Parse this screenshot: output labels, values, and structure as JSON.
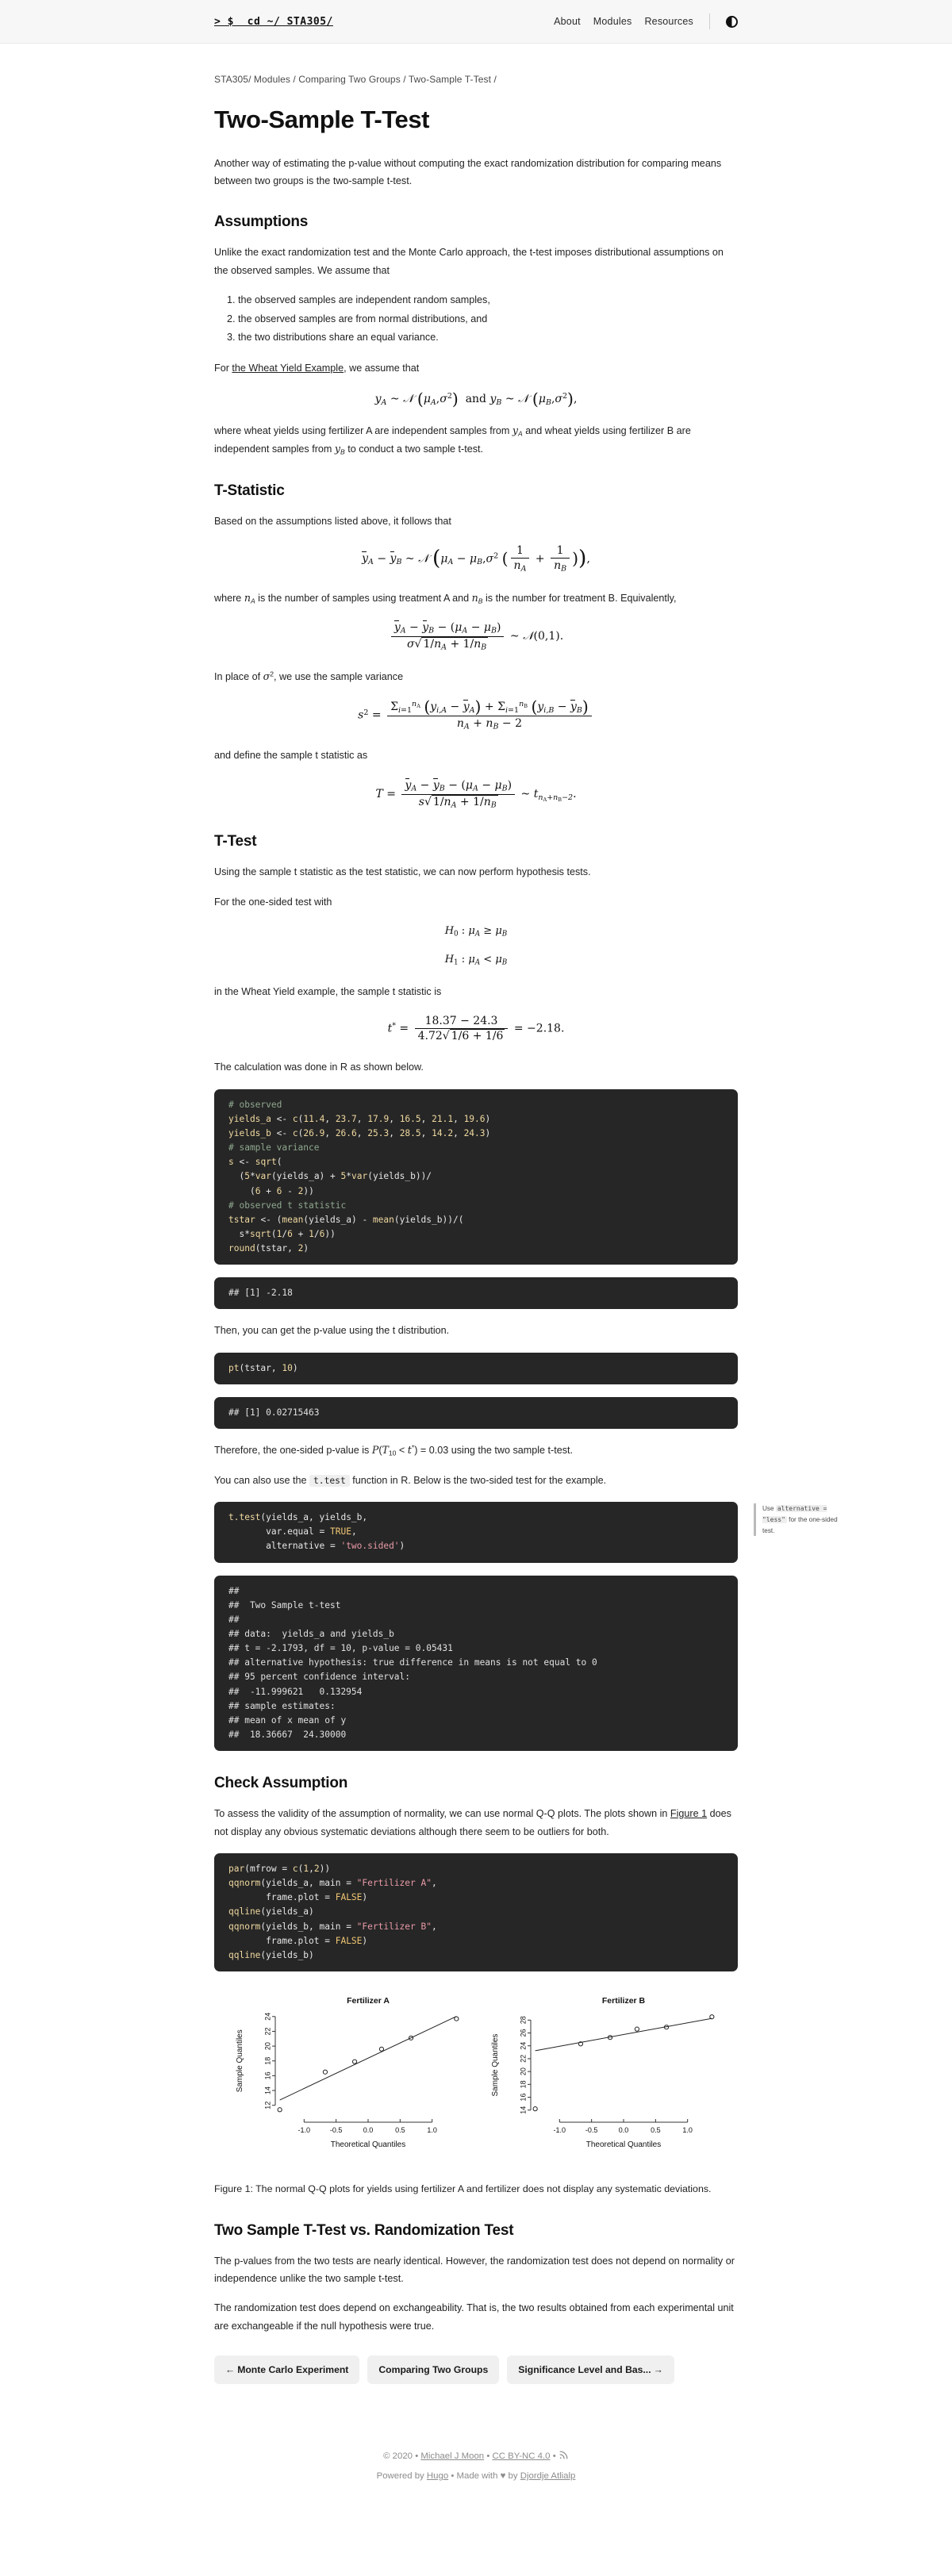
{
  "topbar": {
    "brand": "> $  cd ~/ STA305/",
    "links": [
      "About",
      "Modules",
      "Resources"
    ],
    "theme_toggle_icon": "half-circle-contrast-icon"
  },
  "breadcrumb": "STA305/ Modules / Comparing Two Groups / Two-Sample T-Test /",
  "page_title": "Two-Sample T-Test",
  "intro": "Another way of estimating the p-value without computing the exact randomization distribution for comparing means between two groups is the two-sample t-test.",
  "assumptions": {
    "heading": "Assumptions",
    "para": "Unlike the exact randomization test and the Monte Carlo approach, the t-test imposes distributional assumptions on the observed samples. We assume that",
    "items": [
      "the observed samples are independent random samples,",
      "the observed samples are from normal distributions, and",
      "the two distributions share an equal variance."
    ],
    "for_prefix": "For ",
    "link_text": "the Wheat Yield Example",
    "for_suffix": ", we assume that",
    "after_para": "where wheat yields using fertilizer A are independent samples from yA and wheat yields using fertilizer B are independent samples from yB to conduct a two sample t-test."
  },
  "tstatistic": {
    "heading": "T-Statistic",
    "para1": "Based on the assumptions listed above, it follows that",
    "para2_a": "where ",
    "para2_b": " is the number of samples using treatment A and ",
    "para2_c": " is the number for treatment B. Equivalently,",
    "para3": "In place of σ², we use the sample variance",
    "para4": "and define the sample t statistic as"
  },
  "ttest": {
    "heading": "T-Test",
    "para1": "Using the sample t statistic as the test statistic, we can now perform hypothesis tests.",
    "para2": "For the one-sided test with",
    "para3": "in the Wheat Yield example, the sample t statistic is",
    "para4": "The calculation was done in R as shown below.",
    "code1": [
      "# observed",
      "yields_a <- c(11.4, 23.7, 17.9, 16.5, 21.1, 19.6)",
      "yields_b <- c(26.9, 26.6, 25.3, 28.5, 14.2, 24.3)",
      "# sample variance",
      "s <- sqrt(",
      "  (5*var(yields_a) + 5*var(yields_b))/",
      "    (6 + 6 - 2))",
      "# observed t statistic",
      "tstar <- (mean(yields_a) - mean(yields_b))/(",
      "  s*sqrt(1/6 + 1/6))",
      "round(tstar, 2)"
    ],
    "out1": "## [1] -2.18",
    "para5": "Then, you can get the p-value using the t distribution.",
    "code2": "pt(tstar, 10)",
    "out2": "## [1] 0.02715463",
    "para6_a": "Therefore, the one-sided p-value is ",
    "para6_b": " using the two sample t-test.",
    "para7_a": "You can also use the ",
    "para7_code": "t.test",
    "para7_b": " function in R. Below is the two-sided test for the example.",
    "code3": [
      "t.test(yields_a, yields_b,",
      "       var.equal = TRUE,",
      "       alternative = 'two.sided')"
    ],
    "side_note_a": "Use ",
    "side_note_code1": "alternative = \"less\"",
    "side_note_b": " for the one-sided test.",
    "out3": [
      "## ",
      "##  Two Sample t-test",
      "## ",
      "## data:  yields_a and yields_b",
      "## t = -2.1793, df = 10, p-value = 0.05431",
      "## alternative hypothesis: true difference in means is not equal to 0",
      "## 95 percent confidence interval:",
      "##  -11.999621   0.132954",
      "## sample estimates:",
      "## mean of x mean of y",
      "##  18.36667  24.30000"
    ]
  },
  "check": {
    "heading": "Check Assumption",
    "para": "To assess the validity of the assumption of normality, we can use normal Q-Q plots. The plots shown in Figure 1 does not display any obvious systematic deviations although there seem to be outliers for both.",
    "figure_link_text": "Figure 1",
    "code": [
      "par(mfrow = c(1,2))",
      "qqnorm(yields_a, main = \"Fertilizer A\",",
      "       frame.plot = FALSE)",
      "qqline(yields_a)",
      "qqnorm(yields_b, main = \"Fertilizer B\",",
      "       frame.plot = FALSE)",
      "qqline(yields_b)"
    ],
    "caption": "Figure 1: The normal Q-Q plots for yields using fertilizer A and fertilizer does not display any systematic deviations."
  },
  "comparison": {
    "heading": "Two Sample T-Test vs. Randomization Test",
    "para1": "The p-values from the two tests are nearly identical. However, the randomization test does not depend on normality or independence unlike the two sample t-test.",
    "para2": "The randomization test does depend on exchangeability. That is, the two results obtained from each experimental unit are exchangeable if the null hypothesis were true."
  },
  "pager": {
    "prev_label": "Monte Carlo Experiment",
    "prev_arrow": "←",
    "up_label": "Comparing Two Groups",
    "next_label": "Significance Level and Bas...",
    "next_arrow": "→"
  },
  "footer": {
    "copyright": "© 2020",
    "dot": "•",
    "author": "Michael J Moon",
    "license": "CC BY-NC 4.0",
    "rss_icon": "rss-icon",
    "powered_prefix": "Powered by ",
    "powered_link": "Hugo",
    "made_prefix": "Made with ",
    "heart": "♥",
    "made_by": " by ",
    "made_link": "Djordje Atlialp"
  },
  "chart_data": [
    {
      "type": "scatter",
      "title": "Fertilizer A",
      "xlabel": "Theoretical Quantiles",
      "ylabel": "Sample Quantiles",
      "xticks": [
        -1.0,
        -0.5,
        0.0,
        0.5,
        1.0
      ],
      "yticks": [
        12,
        14,
        16,
        18,
        20,
        22,
        24
      ],
      "xlim": [
        -1.45,
        1.45
      ],
      "ylim": [
        11.0,
        24.3
      ],
      "points": [
        {
          "x": -1.38,
          "y": 11.4
        },
        {
          "x": -0.67,
          "y": 16.5
        },
        {
          "x": -0.21,
          "y": 17.9
        },
        {
          "x": 0.21,
          "y": 19.6
        },
        {
          "x": 0.67,
          "y": 21.1
        },
        {
          "x": 1.38,
          "y": 23.7
        }
      ],
      "qqline": {
        "slope": 4.1,
        "intercept": 18.37
      },
      "grid": false,
      "legend": "none"
    },
    {
      "type": "scatter",
      "title": "Fertilizer B",
      "xlabel": "Theoretical Quantiles",
      "ylabel": "Sample Quantiles",
      "xticks": [
        -1.0,
        -0.5,
        0.0,
        0.5,
        1.0
      ],
      "yticks": [
        14,
        16,
        18,
        20,
        22,
        24,
        26,
        28
      ],
      "xlim": [
        -1.45,
        1.45
      ],
      "ylim": [
        13.6,
        28.9
      ],
      "points": [
        {
          "x": -1.38,
          "y": 14.2
        },
        {
          "x": -0.67,
          "y": 24.3
        },
        {
          "x": -0.21,
          "y": 25.3
        },
        {
          "x": 0.21,
          "y": 26.6
        },
        {
          "x": 0.67,
          "y": 26.9
        },
        {
          "x": 1.38,
          "y": 28.5
        }
      ],
      "qqline": {
        "slope": 1.82,
        "intercept": 25.75
      },
      "grid": false,
      "legend": "none"
    }
  ]
}
